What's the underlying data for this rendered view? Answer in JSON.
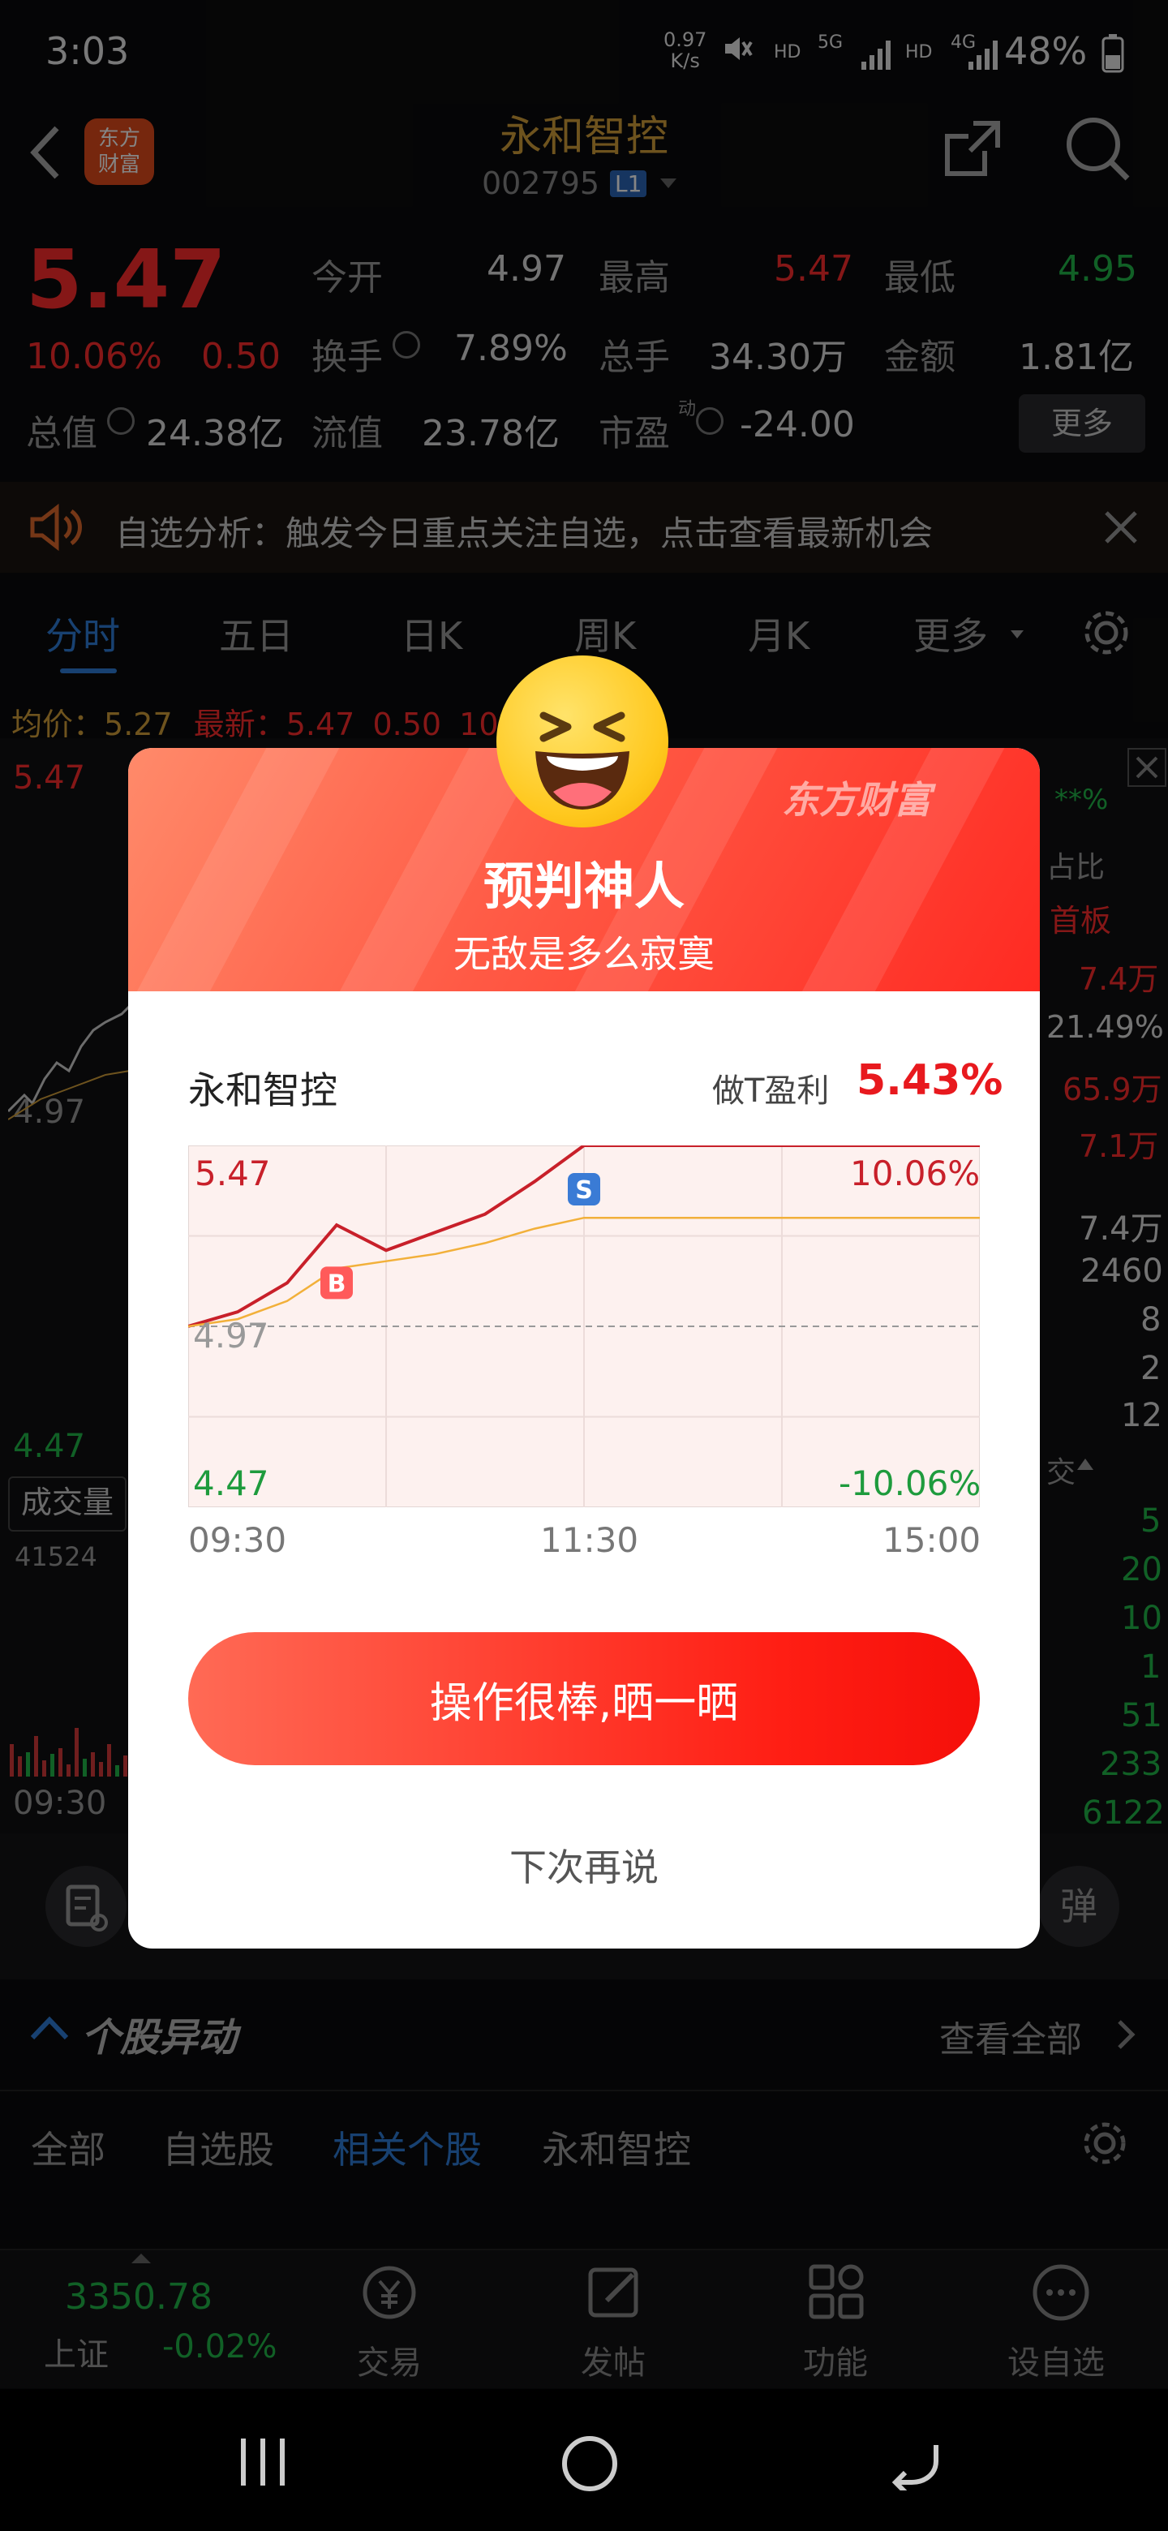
{
  "status_bar": {
    "time": "3:03",
    "speed_value": "0.97",
    "speed_unit": "K/s",
    "net1": "HD",
    "net2": "5G",
    "net3": "HD",
    "net4": "4G",
    "battery": "48%"
  },
  "header": {
    "stock_name": "永和智控",
    "stock_code": "002795",
    "level_badge": "L1",
    "logo_text_1": "东方",
    "logo_text_2": "财富"
  },
  "quote": {
    "price": "5.47",
    "change_pct": "10.06%",
    "change_abs": "0.50",
    "labels": {
      "open": "今开",
      "high": "最高",
      "low": "最低",
      "turnover": "换手",
      "volume": "总手",
      "amount": "金额",
      "market_cap": "总值",
      "float_cap": "流值",
      "pe": "市盈",
      "pe_sup": "动"
    },
    "values": {
      "open": "4.97",
      "high": "5.47",
      "low": "4.95",
      "turnover": "7.89%",
      "volume": "34.30万",
      "amount": "1.81亿",
      "market_cap": "24.38亿",
      "float_cap": "23.78亿",
      "pe": "-24.00"
    },
    "more_button": "更多"
  },
  "notice": {
    "text": "自选分析：触发今日重点关注自选，点击查看最新机会"
  },
  "chart_tabs": [
    "分时",
    "五日",
    "日K",
    "周K",
    "月K",
    "更多"
  ],
  "chart_info": {
    "avg_label": "均价：",
    "avg_value": "5.27",
    "latest_label": "最新：",
    "latest_value": "5.47",
    "latest_change": "0.50",
    "latest_pct": "10.06%"
  },
  "bg_chart": {
    "top_price": "5.47",
    "mid_price": "4.97",
    "bottom_price": "4.47",
    "volume_label": "成交量",
    "volume_value": "41524",
    "time_start": "09:30"
  },
  "bg_side": {
    "top_marker": "**%",
    "ratio_link": "占比",
    "board": "首板",
    "values_red": [
      "7.4万",
      "21.49%",
      "65.9万",
      "7.1万"
    ],
    "orders": [
      "7.4万",
      "2460",
      "8",
      "2",
      "12"
    ],
    "trade_header": "交",
    "trades": [
      "5",
      "20",
      "10",
      "1",
      "51",
      "233",
      "6122"
    ]
  },
  "danmu_label": "弹",
  "stock_movement": {
    "title": "个股异动",
    "view_all": "查看全部",
    "tabs": [
      "全部",
      "自选股",
      "相关个股",
      "永和智控"
    ]
  },
  "bottom_nav": {
    "index_value": "3350.78",
    "index_name": "上证",
    "index_change": "-0.02%",
    "items": [
      "交易",
      "发帖",
      "功能",
      "设自选"
    ]
  },
  "modal": {
    "brand": "东方财富",
    "title": "预判神人",
    "subtitle": "无敌是多么寂寞",
    "stock_name": "永和智控",
    "profit_label": "做T盈利",
    "profit_value": "5.43%",
    "y_top": "5.47",
    "y_mid": "4.97",
    "y_bottom": "4.47",
    "pct_top": "10.06%",
    "pct_bottom": "-10.06%",
    "x_labels": [
      "09:30",
      "11:30",
      "15:00"
    ],
    "buy_marker": "B",
    "sell_marker": "S",
    "share_button": "操作很棒,晒一晒",
    "later_button": "下次再说"
  },
  "chart_data": {
    "type": "line",
    "x": [
      "09:30",
      "09:45",
      "10:00",
      "10:15",
      "10:30",
      "10:45",
      "11:00",
      "11:15",
      "11:30",
      "15:00"
    ],
    "series": [
      {
        "values": [
          4.97,
          5.01,
          5.09,
          5.25,
          5.18,
          5.23,
          5.28,
          5.37,
          5.47,
          5.47
        ]
      },
      {
        "values": [
          4.97,
          4.99,
          5.04,
          5.13,
          5.15,
          5.17,
          5.2,
          5.24,
          5.27,
          5.27
        ]
      }
    ],
    "ylim": [
      4.47,
      5.47
    ],
    "colors": {
      "price": "#c8202a",
      "avg": "#f2b03a",
      "marker_buy": "#ff5a5a",
      "marker_sell": "#3a7bd5"
    }
  }
}
